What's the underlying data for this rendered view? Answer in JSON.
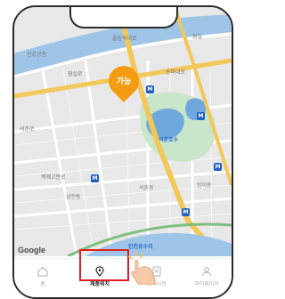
{
  "map": {
    "pin_label": "가능",
    "labels": {
      "l1": "한강공원",
      "l2": "올림픽대로",
      "l3": "잠실로",
      "l4": "석촌호수",
      "l5": "석촌로",
      "l6": "백제고분로",
      "l7": "삼전동",
      "l8": "석촌동",
      "l9": "탄천유수지",
      "l10": "송파대로",
      "l11": "잠실",
      "l12": "방이동"
    },
    "station_letter": "M",
    "google": "Google"
  },
  "nav": {
    "home": "홈",
    "location": "제품위치",
    "notice": "공지사항",
    "mypage": "마이페이지"
  },
  "colors": {
    "pin": "#f39c12",
    "highlight": "#e02020",
    "water": "#9ec5e8",
    "park": "#c8e6c9"
  }
}
